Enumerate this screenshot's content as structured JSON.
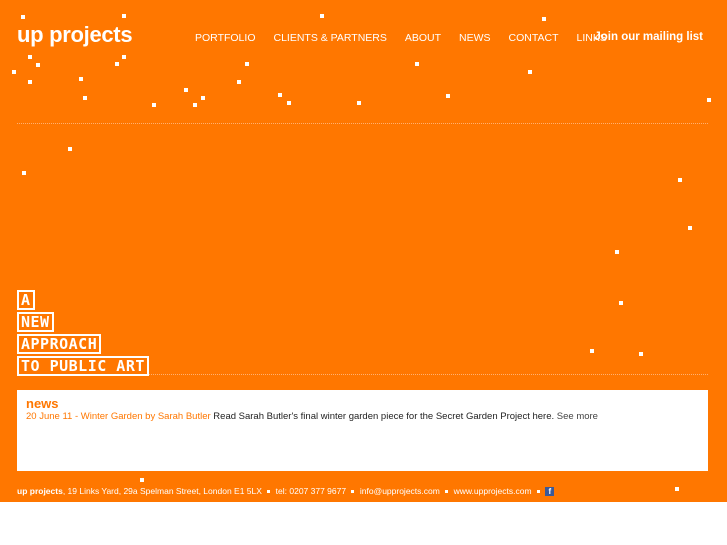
{
  "header": {
    "logo": "up projects",
    "nav": [
      "PORTFOLIO",
      "CLIENTS & PARTNERS",
      "ABOUT",
      "NEWS",
      "CONTACT",
      "LINKS"
    ],
    "mailing_list": "Join our mailing list"
  },
  "tagline": [
    "A",
    "NEW",
    "APPROACH",
    "TO PUBLIC ART"
  ],
  "news": {
    "heading": "news",
    "date_link": "20 June 11 - Winter Garden by Sarah Butler",
    "text": " Read Sarah Butler's final winter garden piece for the Secret Garden Project here. ",
    "more": "See more"
  },
  "footer": {
    "name": "up projects",
    "address": ", 19 Links Yard, 29a Spelman Street, London E1 5LX",
    "tel": "tel: 0207 377 9677",
    "email": "info@upprojects.com",
    "web": "www.upprojects.com",
    "facebook_icon": "facebook-icon"
  },
  "colors": {
    "background": "#ff7700",
    "accent": "#ff7700",
    "text": "#ffffff"
  }
}
